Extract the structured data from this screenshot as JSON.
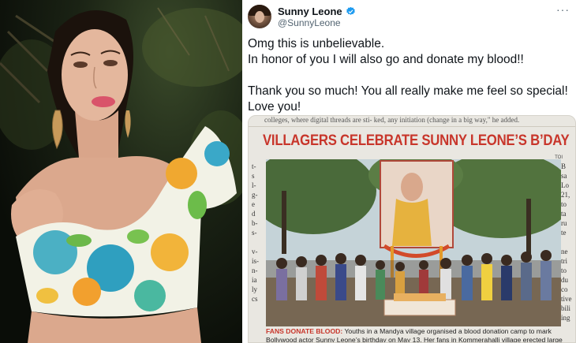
{
  "photo": {
    "description_icon": "portrait-photo"
  },
  "tweet": {
    "display_name": "Sunny Leone",
    "handle": "@SunnyLeone",
    "more_glyph": "···",
    "lines": [
      "Omg this is unbelievable.",
      "In honor of you I will also go and donate my blood!!",
      "",
      "Thank you so much! You all really make me feel so special!",
      "Love you!"
    ],
    "verified_color": "#1d9bf0"
  },
  "clipping": {
    "top_strip": "colleges,     where digital threads are sti-      ked, any initiation (change       in a big way,\" he added.",
    "headline": "VILLAGERS CELEBRATE SUNNY LEONE’S B’DAY",
    "toi_label": "TOI",
    "left_col": "t-\ns\nl-\ng-\ne\nd\nb-\ns-\n\nv-\nis-\nn-\nia\nly\ncs",
    "right_col": "B\nsa\nLo\n21,\nto\nta\nru\nte\n\nne\ntri\nto\ndu\nco\ntive\nbili\ning",
    "caption_lead": "FANS DONATE BLOOD:",
    "caption_text": " Youths in a Mandya village organised a blood donation camp to mark Bollywood actor Sunny Leone’s birthday on May 13. Her fans in Kommerahalli village erected large cutouts of Leone,",
    "headline_color": "#c8362b"
  }
}
